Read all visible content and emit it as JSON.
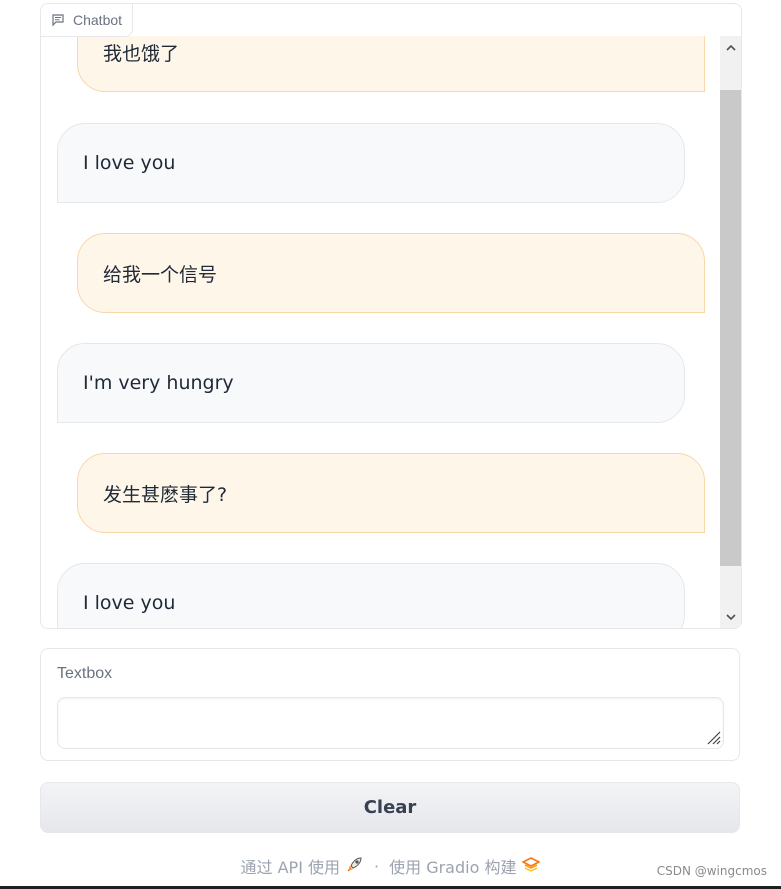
{
  "chatbot": {
    "label": "Chatbot",
    "icon": "chat-icon",
    "messages": [
      {
        "role": "user",
        "text": "我也饿了"
      },
      {
        "role": "bot",
        "text": "I love you"
      },
      {
        "role": "user",
        "text": "给我一个信号"
      },
      {
        "role": "bot",
        "text": "I'm very hungry"
      },
      {
        "role": "user",
        "text": "发生甚麽事了?"
      },
      {
        "role": "bot",
        "text": "I love you"
      }
    ]
  },
  "textbox": {
    "label": "Textbox",
    "value": "",
    "placeholder": ""
  },
  "buttons": {
    "clear_label": "Clear"
  },
  "footer": {
    "api_text": "通过 API 使用",
    "api_icon": "rocket-icon",
    "separator": "·",
    "built_text": "使用 Gradio 构建",
    "built_icon": "gradio-logo-icon"
  },
  "watermark": "CSDN @wingcmos",
  "colors": {
    "user_bubble_bg": "#fff6ea",
    "user_bubble_border": "#f8d7a6",
    "bot_bubble_bg": "#f8f9fb",
    "bot_bubble_border": "#e5e7eb"
  }
}
